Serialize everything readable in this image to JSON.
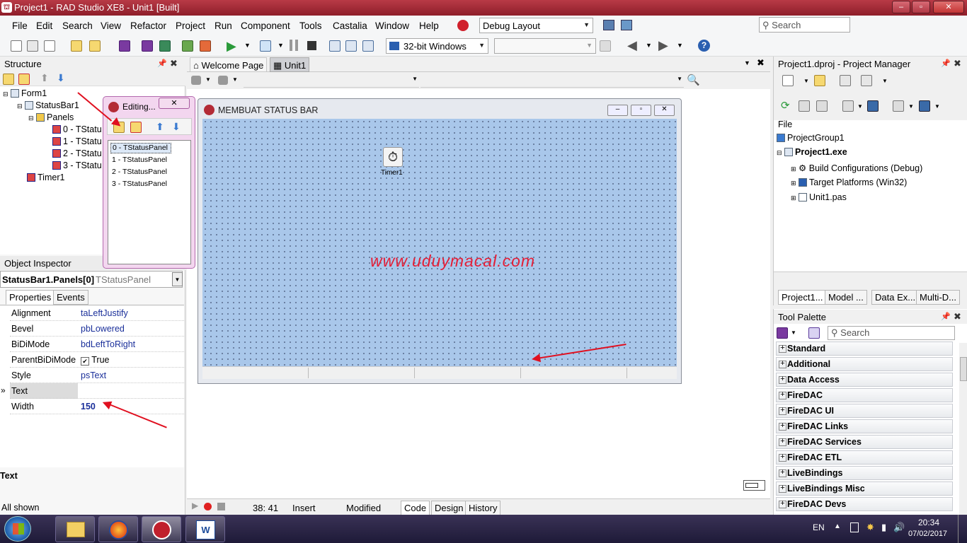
{
  "window": {
    "title": "Project1 - RAD Studio XE8 - Unit1 [Built]"
  },
  "menu": [
    "File",
    "Edit",
    "Search",
    "View",
    "Refactor",
    "Project",
    "Run",
    "Component",
    "Tools",
    "Castalia",
    "Window",
    "Help"
  ],
  "layout_combo": "Debug Layout",
  "search_placeholder": "Search",
  "platform_combo": "32-bit Windows",
  "structure": {
    "title": "Structure",
    "form": "Form1",
    "statusbar": "StatusBar1",
    "panels": "Panels",
    "items": [
      "0 - TStatu",
      "1 - TStatu",
      "2 - TStatu",
      "3 - TStatu"
    ],
    "timer": "Timer1"
  },
  "editing": {
    "title": "Editing...",
    "items": [
      "0 - TStatusPanel",
      "1 - TStatusPanel",
      "2 - TStatusPanel",
      "3 - TStatusPanel"
    ]
  },
  "tabs": {
    "welcome": "Welcome Page",
    "unit": "Unit1"
  },
  "form": {
    "caption": "MEMBUAT STATUS BAR",
    "timer_label": "Timer1",
    "watermark": "www.uduymacal.com"
  },
  "inspector": {
    "title": "Object Inspector",
    "object": "StatusBar1.Panels[0]",
    "object_type": "TStatusPanel",
    "tab_properties": "Properties",
    "tab_events": "Events",
    "rows": [
      [
        "Alignment",
        "taLeftJustify"
      ],
      [
        "Bevel",
        "pbLowered"
      ],
      [
        "BiDiMode",
        "bdLeftToRight"
      ],
      [
        "ParentBiDiMode",
        "True"
      ],
      [
        "Style",
        "psText"
      ],
      [
        "Text",
        ""
      ],
      [
        "Width",
        "150"
      ]
    ],
    "desc": "Text",
    "status": "All shown"
  },
  "editor_status": {
    "position": "38:  41",
    "mode": "Insert",
    "modified": "Modified",
    "tab_code": "Code",
    "tab_design": "Design",
    "tab_history": "History"
  },
  "project_manager": {
    "title": "Project1.dproj - Project Manager",
    "col": "File",
    "items": [
      "ProjectGroup1",
      "Project1.exe",
      "Build Configurations (Debug)",
      "Target Platforms (Win32)",
      "Unit1.pas"
    ],
    "tabs": [
      "Project1...",
      "Model ...",
      "Data Ex...",
      "Multi-D..."
    ]
  },
  "tool_palette": {
    "title": "Tool Palette",
    "search": "Search",
    "categories": [
      "Standard",
      "Additional",
      "Data Access",
      "FireDAC",
      "FireDAC UI",
      "FireDAC Links",
      "FireDAC Services",
      "FireDAC ETL",
      "LiveBindings",
      "LiveBindings Misc",
      "FireDAC Devs"
    ]
  },
  "taskbar": {
    "lang": "EN",
    "time": "20:34",
    "date": "07/02/2017"
  }
}
